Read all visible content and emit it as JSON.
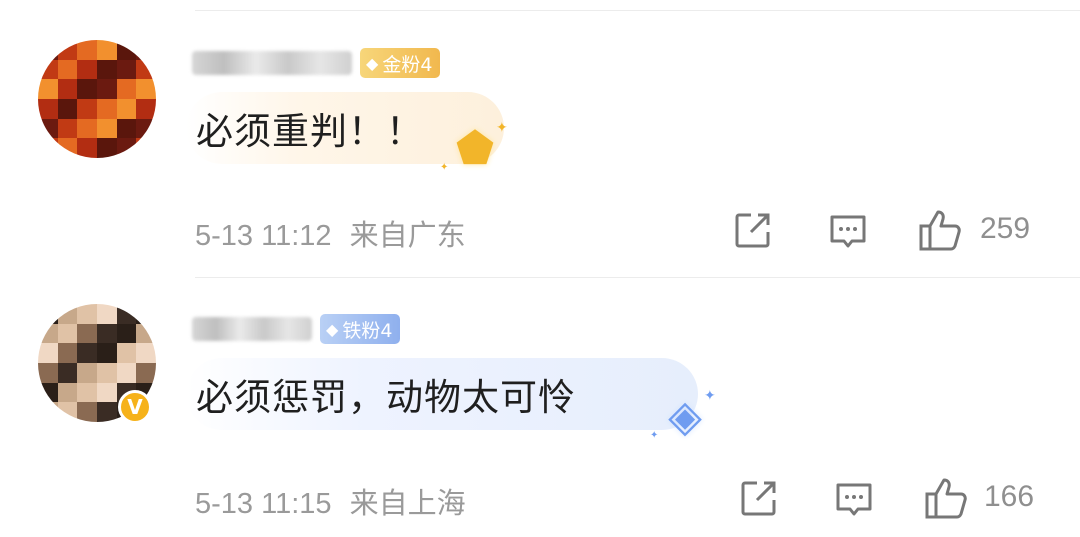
{
  "comments": [
    {
      "username": "",
      "fan_badge": "金粉4",
      "text": "必须重判！！",
      "timestamp": "5-13 11:12",
      "location": "来自广东",
      "likes": "259",
      "avatar_colors": [
        "#6b1a10",
        "#c13a14",
        "#e46a22",
        "#f2902e",
        "#b22d12",
        "#5a160c"
      ],
      "verified": false
    },
    {
      "username": "",
      "fan_badge": "铁粉4",
      "text": "必须惩罚，动物太可怜",
      "timestamp": "5-13 11:15",
      "location": "来自上海",
      "likes": "166",
      "avatar_colors": [
        "#2a1f18",
        "#c7a88a",
        "#e0c2a6",
        "#f0d8c4",
        "#8a6a52",
        "#3a2c24"
      ],
      "verified": true
    }
  ],
  "icons": {
    "share": "share-icon",
    "comment": "comment-icon",
    "like": "thumbs-up-icon",
    "verified": "verified-v-icon"
  },
  "colors": {
    "gold_badge": "#f1b84e",
    "iron_badge": "#8fb0ee",
    "meta_gray": "#9a9a9a",
    "verified_orange": "#f6b21a"
  }
}
